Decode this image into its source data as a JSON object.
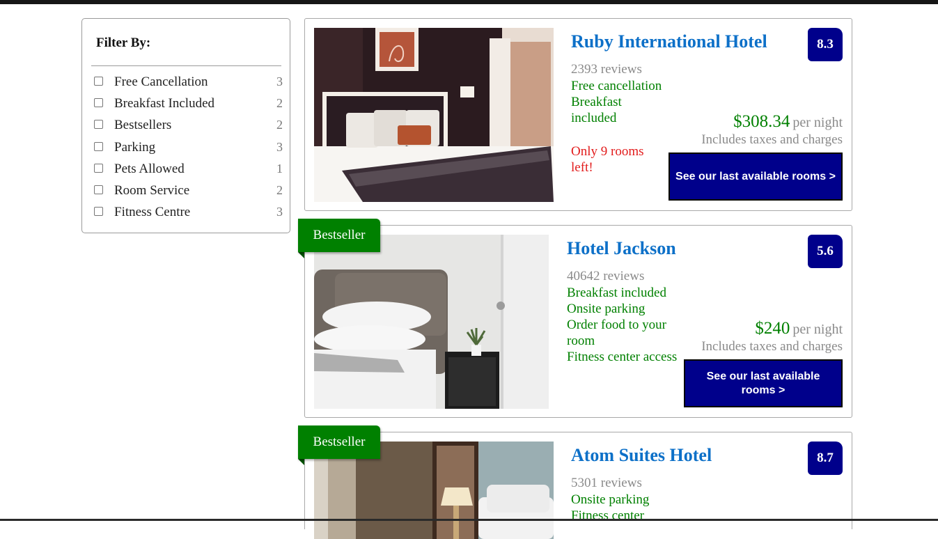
{
  "filters": {
    "title": "Filter By:",
    "items": [
      {
        "label": "Free Cancellation",
        "count": "3"
      },
      {
        "label": "Breakfast Included",
        "count": "2"
      },
      {
        "label": "Bestsellers",
        "count": "2"
      },
      {
        "label": "Parking",
        "count": "3"
      },
      {
        "label": "Pets Allowed",
        "count": "1"
      },
      {
        "label": "Room Service",
        "count": "2"
      },
      {
        "label": "Fitness Centre",
        "count": "3"
      }
    ]
  },
  "hotels": [
    {
      "name": "Ruby International Hotel",
      "score": "8.3",
      "reviews": "2393 reviews",
      "features": [
        "Free cancellation",
        "Breakfast",
        "included"
      ],
      "rooms_left": [
        "Only 9 rooms",
        "left!"
      ],
      "price": "$308.34",
      "per_night": "per night",
      "taxes": "Includes taxes and charges",
      "cta": "See our last available rooms >"
    },
    {
      "badge": "Bestseller",
      "name": "Hotel Jackson",
      "score": "5.6",
      "reviews": "40642 reviews",
      "features": [
        "Breakfast included",
        "Onsite parking",
        "Order food to your",
        "room",
        "Fitness center access"
      ],
      "price": "$240",
      "per_night": "per night",
      "taxes": "Includes taxes and charges",
      "cta": "See our last available rooms >"
    },
    {
      "badge": "Bestseller",
      "name": "Atom Suites Hotel",
      "score": "8.7",
      "reviews": "5301 reviews",
      "features": [
        "Onsite parking",
        "Fitness center"
      ]
    }
  ],
  "colors": {
    "link_blue": "#0d70c8",
    "score_bg": "#00008b",
    "feature_green": "#008000",
    "alert_red": "#e21b1b",
    "muted_gray": "#8a8a8a"
  }
}
